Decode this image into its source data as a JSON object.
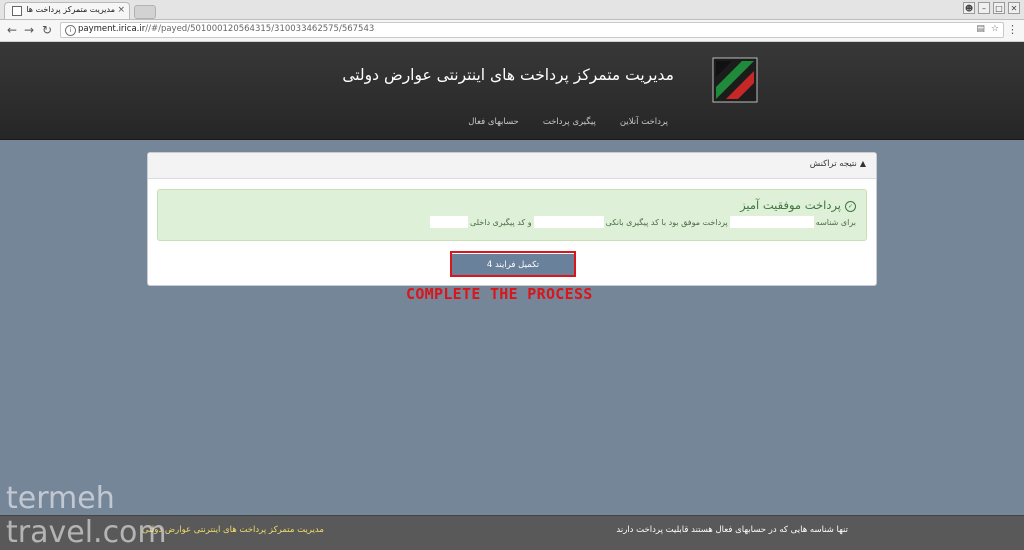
{
  "browser": {
    "tab_title": "مدیریت متمرکز پرداخت های",
    "tab_close": "×",
    "url_host": "payment.irica.ir",
    "url_path": "//#/payed/501000120564315/310033462575/567543"
  },
  "header": {
    "title": "مدیریت متمرکز پرداخت های اینترنتی عوارض دولتی",
    "nav": [
      "پرداخت آنلاین",
      "پیگیری پرداخت",
      "حسابهای فعال"
    ]
  },
  "panel": {
    "heading": "نتیجه تراکنش",
    "alert_title": "پرداخت موفقیت آمیز",
    "line_part1": "برای شناسه",
    "line_part2": "پرداخت موفق بود با کد پیگیری بانکی",
    "line_part3": "و کد پیگیری داخلی",
    "button_label": "تکمیل فرایند 4"
  },
  "annotation": "COMPLETE THE PROCESS",
  "footer": {
    "left": "مدیریت متمرکز پرداخت های اینترنتی عوارض دولتی",
    "right": "تنها شناسه هایی که در حسابهای فعال هستند قابلیت پرداخت دارند"
  },
  "watermark": {
    "line1": "termeh",
    "line2": "travel.com"
  },
  "colors": {
    "page_bg": "#768699",
    "header_bg": "#2d2d2d",
    "alert_green": "#3c763d",
    "button_bg": "#69819a",
    "highlight_red": "#d8161c",
    "footer_link": "#f0dd6a"
  }
}
